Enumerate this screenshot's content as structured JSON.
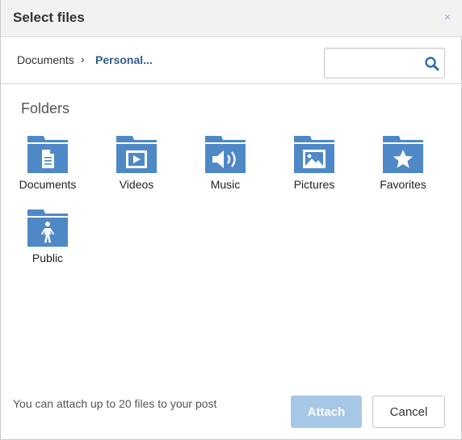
{
  "dialog": {
    "title": "Select files",
    "close_label": "×"
  },
  "breadcrumb": {
    "root": "Documents",
    "separator": "›",
    "current": "Personal..."
  },
  "search": {
    "value": "",
    "placeholder": "",
    "icon": "search-icon"
  },
  "folders": {
    "heading": "Folders",
    "items": [
      {
        "label": "Documents",
        "icon": "document-icon"
      },
      {
        "label": "Videos",
        "icon": "video-icon"
      },
      {
        "label": "Music",
        "icon": "speaker-icon"
      },
      {
        "label": "Pictures",
        "icon": "picture-icon"
      },
      {
        "label": "Favorites",
        "icon": "star-icon"
      },
      {
        "label": "Public",
        "icon": "person-icon"
      }
    ]
  },
  "footer": {
    "note": "You can attach up to 20 files to your post",
    "attach_label": "Attach",
    "cancel_label": "Cancel"
  },
  "colors": {
    "folder_blue": "#4f88c6",
    "accent_text": "#2e5c8f",
    "attach_disabled": "#a7c7e7"
  }
}
